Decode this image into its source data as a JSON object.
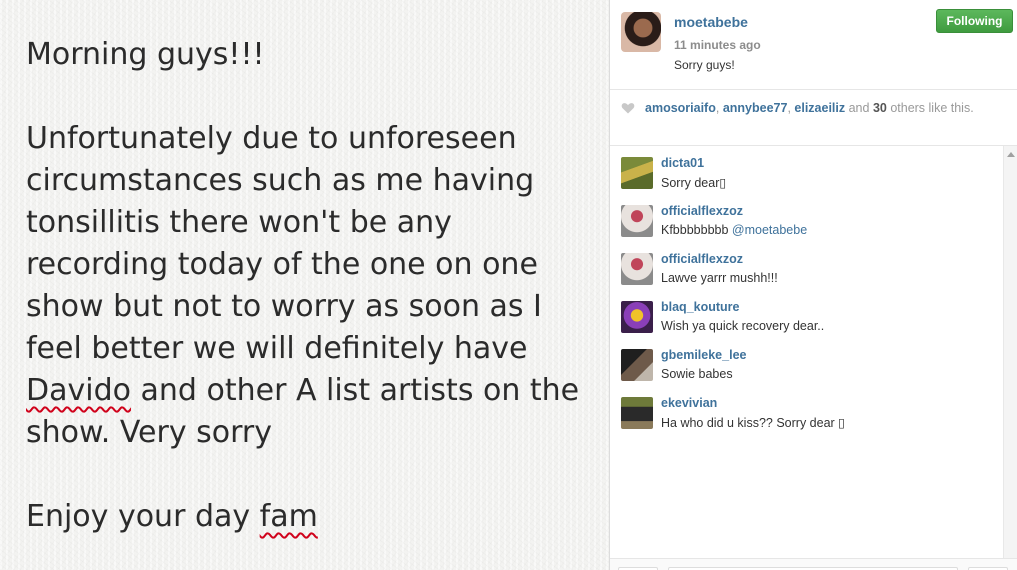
{
  "post": {
    "note_lines": [
      "Morning guys!!!",
      "",
      "Unfortunately due to unforeseen",
      "circumstances such as me having",
      "tonsillitis there won't be any",
      "recording today of the one on one",
      "show but not to worry as soon as I",
      "feel better we will definitely have",
      "Davido and other A list artists on the",
      "show. Very sorry",
      "",
      "Enjoy your day fam"
    ]
  },
  "header": {
    "username": "moetabebe",
    "timestamp": "11 minutes ago",
    "caption": "Sorry guys!",
    "follow_label": "Following"
  },
  "likes": {
    "users": [
      "amosoriaifo",
      "annybee77",
      "elizaeiliz"
    ],
    "sep1": ", ",
    "sep2": ", ",
    "and_text": " and ",
    "count": "30",
    "suffix": " others like this."
  },
  "comments": [
    {
      "user": "dicta01",
      "text": "Sorry dear▯",
      "mention": ""
    },
    {
      "user": "officialflexzoz",
      "text": "Kfbbbbbbbb ",
      "mention": "@moetabebe"
    },
    {
      "user": "officialflexzoz",
      "text": "Lawve yarrr mushh!!!",
      "mention": ""
    },
    {
      "user": "blaq_kouture",
      "text": "Wish ya quick recovery dear..",
      "mention": ""
    },
    {
      "user": "gbemileke_lee",
      "text": "Sowie babes",
      "mention": ""
    },
    {
      "user": "ekevivian",
      "text": "Ha who did u kiss?? Sorry dear ▯",
      "mention": ""
    }
  ],
  "colors": {
    "link": "#3f729b",
    "follow_green": "#4cae4c",
    "spellcheck": "#d0021b"
  }
}
